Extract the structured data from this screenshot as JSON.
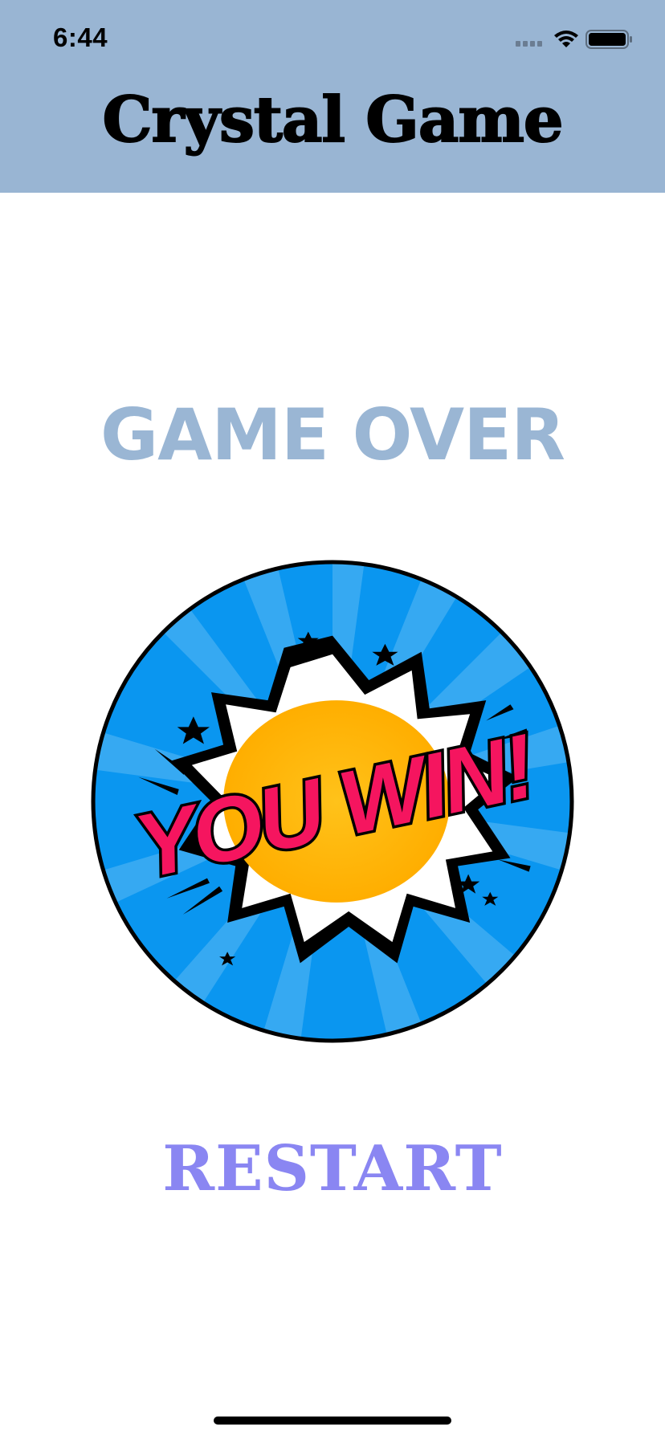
{
  "status_bar": {
    "time": "6:44"
  },
  "header": {
    "title": "Crystal Game"
  },
  "main": {
    "heading": "GAME OVER",
    "badge_text": "YOU WIN!",
    "restart_label": "RESTART"
  },
  "colors": {
    "header_bg": "#99b5d3",
    "heading": "#9ab6d4",
    "restart": "#8a86f2",
    "badge_blue": "#0a96f0",
    "badge_pink": "#f5155f",
    "badge_yellow": "#ffb400"
  }
}
